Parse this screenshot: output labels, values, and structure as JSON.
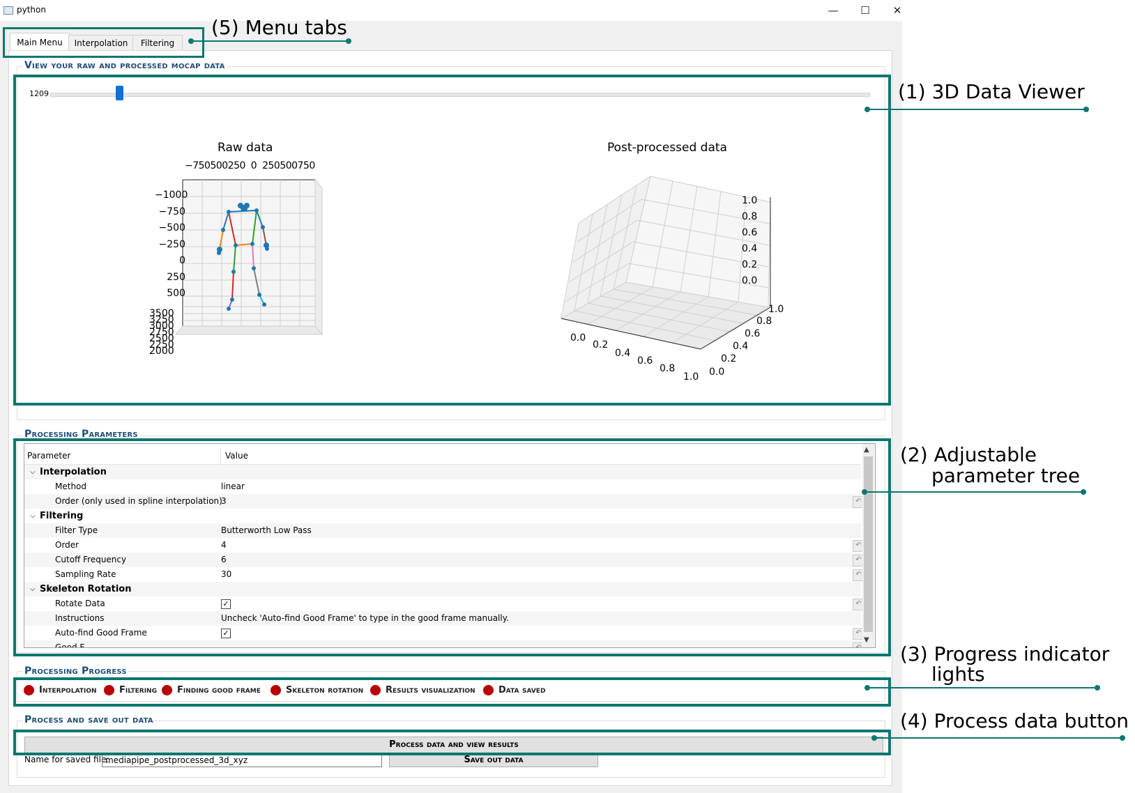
{
  "window": {
    "title": "python",
    "minimize": "—",
    "maximize": "☐",
    "close": "✕"
  },
  "tabs": [
    "Main Menu",
    "Interpolation",
    "Filtering"
  ],
  "viewer": {
    "group_label": "View your raw and processed mocap data",
    "slider_value": "1209",
    "slider_position": 0.08,
    "raw_title": "Raw data",
    "post_title": "Post-processed data",
    "raw_top_ticks": "−750500250  0  250500750",
    "raw_left_ticks": [
      "−1000",
      "−750",
      "−500",
      "−250",
      "0",
      "250",
      "500"
    ],
    "raw_depth_ticks": [
      "3500",
      "3250",
      "3000",
      "2750",
      "2500",
      "2250",
      "2000"
    ],
    "post_z_ticks": [
      "1.0",
      "0.8",
      "0.6",
      "0.4",
      "0.2",
      "0.0"
    ],
    "post_y_ticks": [
      "1.0",
      "0.8",
      "0.6",
      "0.4",
      "0.2",
      "0.0"
    ],
    "post_x_ticks": [
      "0.0",
      "0.2",
      "0.4",
      "0.6",
      "0.8",
      "1.0"
    ]
  },
  "params": {
    "group_label": "Processing Parameters",
    "col_param": "Parameter",
    "col_value": "Value",
    "sections": [
      {
        "name": "Interpolation",
        "rows": [
          {
            "param": "Method",
            "value": "linear"
          },
          {
            "param": "Order (only used in spline interpolation)",
            "value": "3"
          }
        ]
      },
      {
        "name": "Filtering",
        "rows": [
          {
            "param": "Filter Type",
            "value": "Butterworth Low Pass"
          },
          {
            "param": "Order",
            "value": "4"
          },
          {
            "param": "Cutoff Frequency",
            "value": "6"
          },
          {
            "param": "Sampling Rate",
            "value": "30"
          }
        ]
      },
      {
        "name": "Skeleton Rotation",
        "rows": [
          {
            "param": "Rotate Data",
            "value": "✓"
          },
          {
            "param": "Instructions",
            "value": "Uncheck 'Auto-find Good Frame' to type in the good frame manually."
          },
          {
            "param": "Auto-find Good Frame",
            "value": "✓"
          },
          {
            "param": "Good F...",
            "value": ""
          }
        ]
      }
    ]
  },
  "progress": {
    "group_label": "Processing Progress",
    "steps": [
      "Interpolation",
      "Filtering",
      "Finding good frame",
      "Skeleton rotation",
      "Results visualization",
      "Data saved"
    ],
    "light_color": "#b80000"
  },
  "process": {
    "group_label": "Process and save out data",
    "process_button": "Process data and view results",
    "file_label": "Name for saved file:",
    "file_value": "mediapipe_postprocessed_3d_xyz",
    "save_button": "Save out data"
  },
  "annotations": {
    "c1": "(1) 3D Data Viewer",
    "c2a": "(2) Adjustable",
    "c2b": "parameter tree",
    "c3a": "(3) Progress indicator",
    "c3b": "lights",
    "c4": "(4) Process data button",
    "c5": "(5) Menu tabs"
  }
}
